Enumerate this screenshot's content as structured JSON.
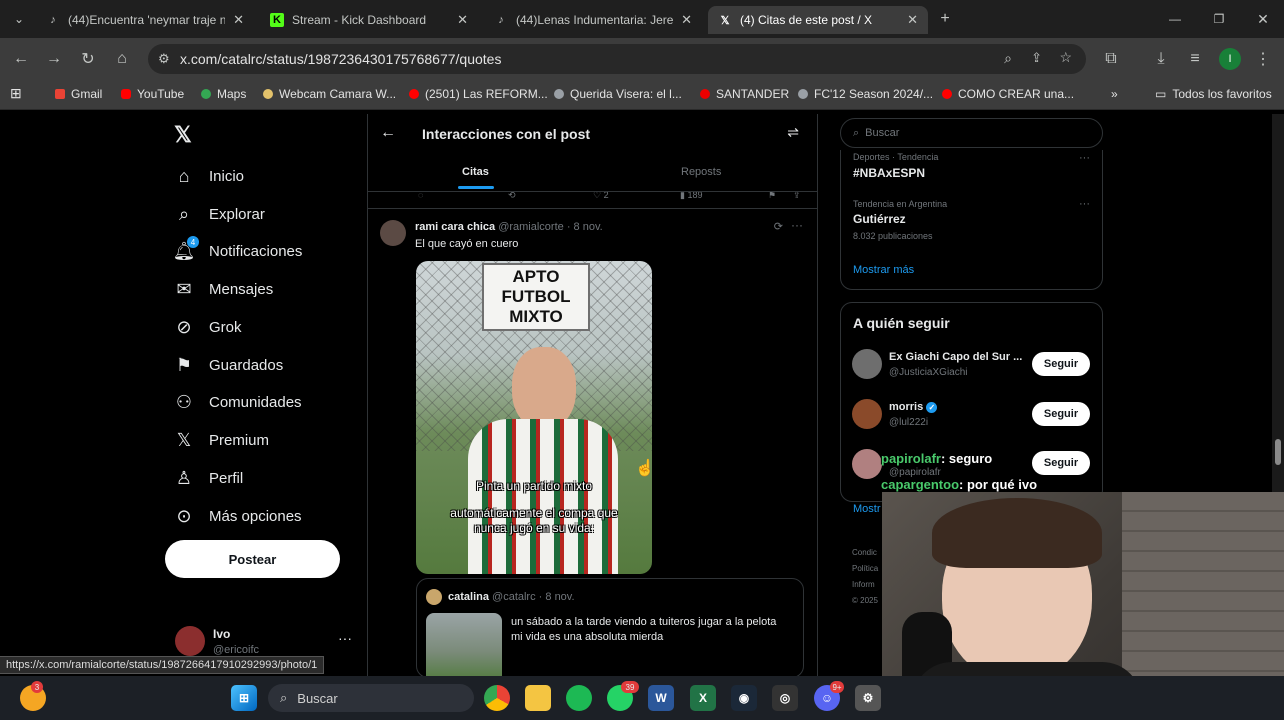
{
  "browser": {
    "tabs": [
      {
        "title": "(44)Encuentra 'neymar traje nec",
        "favicon": "tiktok-icon"
      },
      {
        "title": "Stream - Kick Dashboard",
        "favicon": "kick-icon"
      },
      {
        "title": "(44)Lenas Indumentaria: Jeremy",
        "favicon": "tiktok-icon"
      },
      {
        "title": "(4) Citas de este post / X",
        "favicon": "x-icon"
      }
    ],
    "url": "x.com/catalrc/status/1987236430175768677/quotes",
    "bookmarks": [
      "Gmail",
      "YouTube",
      "Maps",
      "Webcam Camara W...",
      "(2501) Las REFORM...",
      "Querida Visera: el l...",
      "SANTANDER",
      "FC'12 Season 2024/...",
      "COMO CREAR una..."
    ],
    "bookmarks_all": "Todos los favoritos",
    "profile_initial": "I",
    "status_url": "https://x.com/ramialcorte/status/1987266417910292993/photo/1"
  },
  "x_nav": {
    "items": [
      "Inicio",
      "Explorar",
      "Notificaciones",
      "Mensajes",
      "Grok",
      "Guardados",
      "Comunidades",
      "Premium",
      "Perfil",
      "Más opciones"
    ],
    "notif_badge": "4",
    "post_button": "Postear",
    "user_name": "Ivo",
    "user_handle": "@ericoifc"
  },
  "center": {
    "title": "Interacciones con el post",
    "tabs": [
      "Citas",
      "Reposts"
    ],
    "stats_partial": [
      "2",
      "189"
    ],
    "tweet": {
      "name": "rami cara chica",
      "handle": "@ramialcorte",
      "time": "· 8 nov.",
      "text": "El que cayó en cuero",
      "image_sign": [
        "APTO",
        "FUTBOL",
        "MIXTO"
      ],
      "image_caption": [
        "Pinta un partido mixto",
        "automáticamente el compa que",
        "nunca jugó en su vida:"
      ]
    },
    "quoted": {
      "name": "catalina",
      "handle": "@catalrc",
      "time": "· 8 nov.",
      "text": [
        "un sábado a la tarde viendo a tuiteros jugar a la pelota",
        "mi vida es una absoluta mierda"
      ]
    }
  },
  "right": {
    "search_placeholder": "Buscar",
    "trends": [
      {
        "context": "Deportes · Tendencia",
        "name": "#NBAxESPN",
        "count": ""
      },
      {
        "context": "Tendencia en Argentina",
        "name": "Gutiérrez",
        "count": "8.032 publicaciones"
      }
    ],
    "show_more": "Mostrar más",
    "follow_title": "A quién seguir",
    "follow": [
      {
        "name": "Ex Giachi Capo del Sur ...",
        "handle": "@JusticiaXGiachi",
        "button": "Seguir"
      },
      {
        "name": "morris",
        "handle": "@lul222i",
        "button": "Seguir"
      },
      {
        "name": "",
        "handle": "@papirolafr",
        "button": "Seguir"
      }
    ],
    "show_more_partial": "Mostr",
    "footer": [
      "Condic",
      "Política",
      "Inform",
      "© 2025"
    ]
  },
  "chat_overlay": [
    {
      "user": "papirolafr",
      "msg": ": seguro"
    },
    {
      "user": "capargentoo",
      "msg": ": por qué ivo"
    }
  ],
  "taskbar": {
    "search": "Buscar",
    "badges": [
      "3",
      "39",
      "9+"
    ]
  },
  "colors": {
    "accent": "#1d9bf0",
    "chat_user": "#49c96b"
  }
}
